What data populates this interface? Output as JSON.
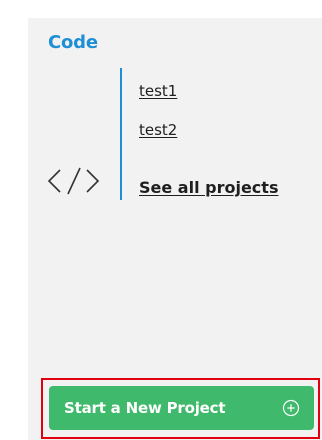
{
  "card": {
    "title": "Code",
    "icon": "code-brackets-icon",
    "projects": [
      {
        "label": "test1"
      },
      {
        "label": "test2"
      }
    ],
    "see_all_label": "See all projects"
  },
  "cta": {
    "label": "Start a New Project",
    "icon": "plus-circle-icon"
  },
  "colors": {
    "accent_blue": "#1e8fd4",
    "button_green": "#3fb96b",
    "highlight_red": "#e0000f",
    "panel_bg": "#f2f2f2",
    "text_dark": "#1f1f1f"
  }
}
